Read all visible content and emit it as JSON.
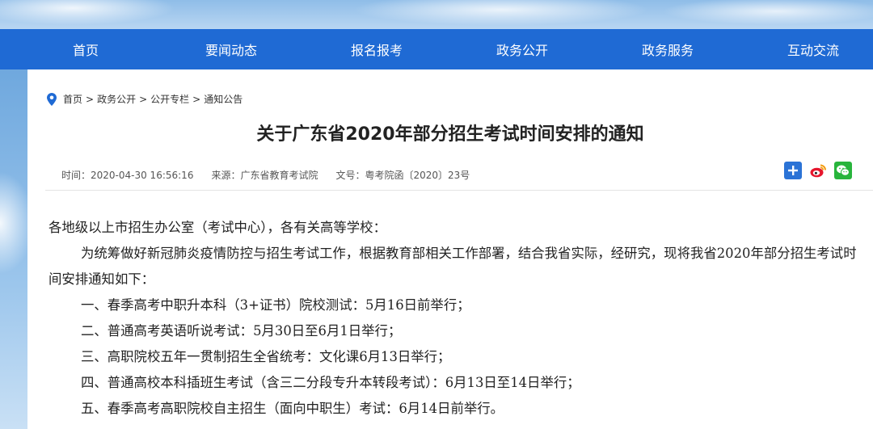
{
  "nav": {
    "items": [
      "首页",
      "要闻动态",
      "报名报考",
      "政务公开",
      "政务服务",
      "互动交流"
    ]
  },
  "breadcrumb": {
    "items": [
      "首页",
      "政务公开",
      "公开专栏",
      "通知公告"
    ],
    "separator": ">"
  },
  "article": {
    "title": "关于广东省2020年部分招生考试时间安排的通知",
    "meta": {
      "time": "时间：2020-04-30 16:56:16",
      "source": "来源：广东省教育考试院",
      "doc_no": "文号：粤考院函〔2020〕23号"
    },
    "share": {
      "icons": [
        "share-plus-icon",
        "weibo-icon",
        "wechat-icon"
      ]
    },
    "body": {
      "salutation": "各地级以上市招生办公室（考试中心），各有关高等学校：",
      "intro": "为统筹做好新冠肺炎疫情防控与招生考试工作，根据教育部相关工作部署，结合我省实际，经研究，现将我省2020年部分招生考试时间安排通知如下：",
      "items": [
        "一、春季高考中职升本科（3+证书）院校测试：5月16日前举行；",
        "二、普通高考英语听说考试：5月30日至6月1日举行；",
        "三、高职院校五年一贯制招生全省统考：文化课6月13日举行；",
        "四、普通高校本科插班生考试（含三二分段专升本转段考试）：6月13日至14日举行；",
        "五、春季高考高职院校自主招生（面向中职生）考试：6月14日前举行。"
      ]
    }
  },
  "colors": {
    "nav_bg": "#1f6ad4",
    "share_plus": "#2b73d6",
    "weibo": "#e6162d",
    "wechat": "#28b43c"
  }
}
